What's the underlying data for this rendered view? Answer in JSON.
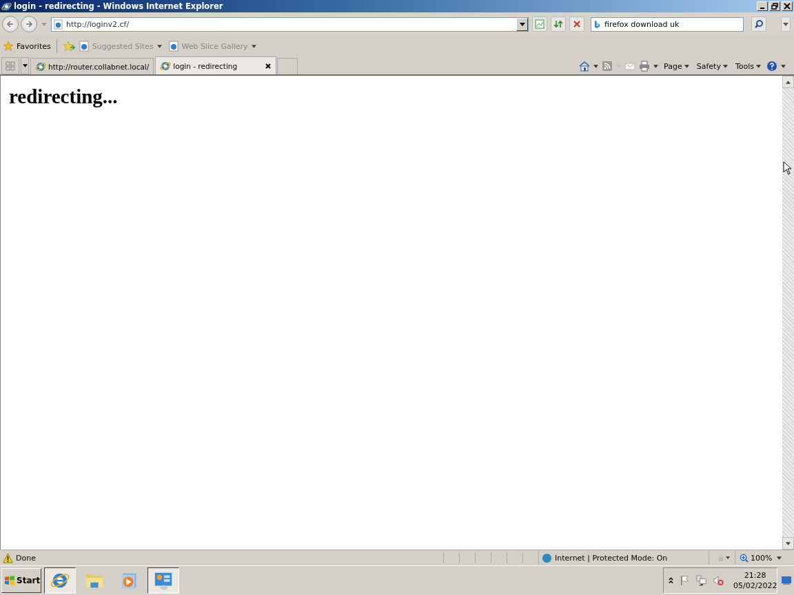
{
  "window": {
    "title": "login - redirecting - Windows Internet Explorer"
  },
  "address": {
    "value": "http://loginv2.cf/"
  },
  "search": {
    "value": "firefox download uk"
  },
  "favorites": {
    "label": "Favorites",
    "links": [
      {
        "label": "Suggested Sites"
      },
      {
        "label": "Web Slice Gallery"
      }
    ]
  },
  "tabs": [
    {
      "label": "http://router.collabnet.local/",
      "selected": false
    },
    {
      "label": "login - redirecting",
      "selected": true
    }
  ],
  "command_bar": [
    "Page",
    "Safety",
    "Tools"
  ],
  "page": {
    "heading": "redirecting..."
  },
  "status_bar": {
    "text": "Done",
    "zone": "Internet | Protected Mode: On",
    "zoom": "100%"
  },
  "taskbar": {
    "start": "Start",
    "apps": [
      {
        "kind": "browser",
        "selected": true
      },
      {
        "kind": "folder",
        "selected": false
      },
      {
        "kind": "media",
        "selected": false
      },
      {
        "kind": "server",
        "selected": true
      }
    ],
    "time": "21:28",
    "date": "05/02/2022"
  }
}
